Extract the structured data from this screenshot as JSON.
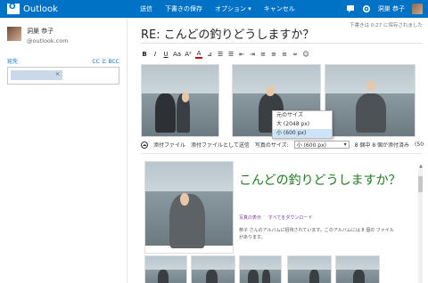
{
  "app": {
    "name": "Outlook"
  },
  "commands": [
    "送信",
    "下書きの保存",
    "オプション ▾",
    "キャンセル"
  ],
  "user": {
    "name": "洞巣 恭子"
  },
  "sender": {
    "name": "洞巣 恭子",
    "email": "@outlook.com"
  },
  "recipients": {
    "to_label": "宛先",
    "cc_bcc": "CC と BCC",
    "chip_close": "×"
  },
  "compose": {
    "saved_notice": "下書きは 0:27 に保存されました",
    "subject": "RE: こんどの釣りどうしますか？"
  },
  "toolbar": [
    "B",
    "I",
    "U",
    "Aa",
    "A²",
    "A",
    "⊿",
    "☰",
    "☰",
    "⇤",
    "⇥",
    "≡",
    "≡",
    "≡",
    "∞",
    "☺"
  ],
  "size_menu": {
    "items": [
      "元のサイズ",
      "大 (2048 px)",
      "小 (600 px)"
    ],
    "selected_index": 2
  },
  "attach_bar": {
    "attach": "添付ファイル",
    "attach_send": "添付ファイルとして送信",
    "photo_size_label": "写真のサイズ:",
    "photo_size_value": "小 (600 px)",
    "count": "8 個中 8 個が添付済み",
    "extra": "(50"
  },
  "album": {
    "title": "こんどの釣りどうしますか？",
    "link_show": "写真の表示",
    "link_download": "すべてをダウンロード",
    "description": "恭子 さんのアルバムに招待されています。このアルバムには 8 個の ファイル があります。"
  },
  "colors": {
    "topbar": "#0072c6",
    "album_title": "#1e7b1e",
    "link": "#7a3a9a"
  }
}
